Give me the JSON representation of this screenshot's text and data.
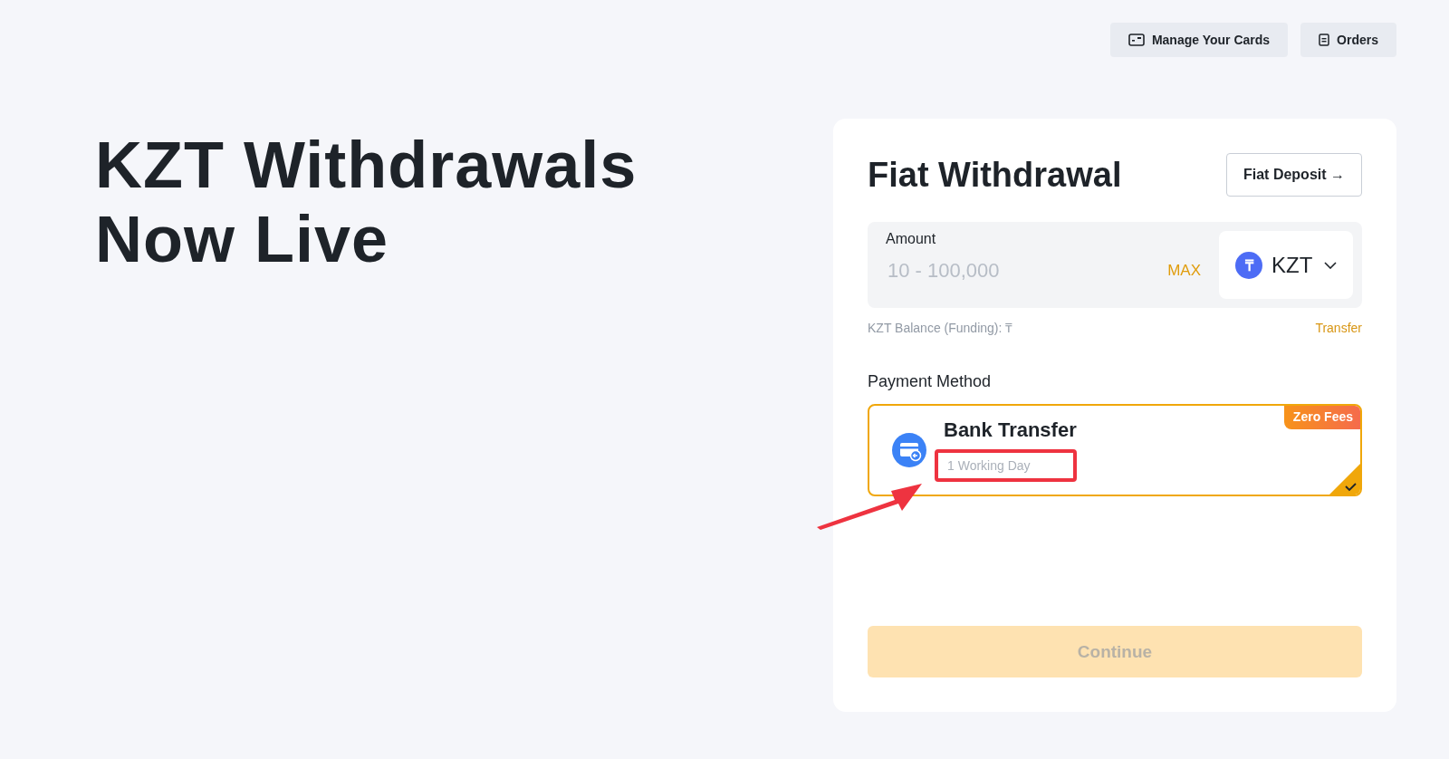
{
  "header_buttons": [
    {
      "kind": "cards",
      "label": "Manage Your Cards"
    },
    {
      "kind": "orders",
      "label": "Orders"
    }
  ],
  "headline": [
    "KZT Withdrawals",
    "Now Live"
  ],
  "form": {
    "title": "Fiat Withdrawal",
    "switch_button": "Fiat Deposit →",
    "amount": {
      "label": "Amount",
      "placeholder": "10 - 100,000",
      "max_label": "MAX",
      "currency": {
        "symbol": "₸",
        "code": "KZT"
      }
    },
    "balance": {
      "label": "KZT Balance (Funding): ₸",
      "transfer_link": "Transfer"
    },
    "payment_section": "Payment Method",
    "methods": [
      {
        "name": "Bank Transfer",
        "time": "1 Working Day",
        "badge": "Zero Fees",
        "selected": true,
        "highlighted": true
      }
    ],
    "continue_button": {
      "label": "Continue",
      "disabled": true
    }
  }
}
